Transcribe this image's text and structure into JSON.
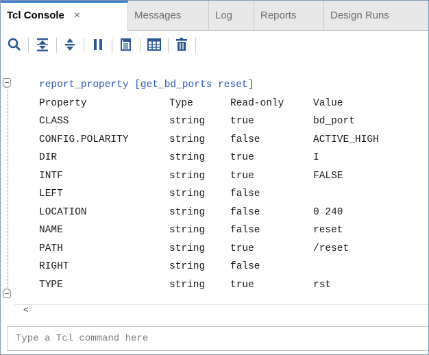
{
  "tabs": [
    {
      "label": "Tcl Console",
      "active": true,
      "close": "×"
    },
    {
      "label": "Messages"
    },
    {
      "label": "Log"
    },
    {
      "label": "Reports"
    },
    {
      "label": "Design Runs"
    }
  ],
  "toolbar": {
    "buttons": [
      "search-icon",
      "collapse-all-icon",
      "expand-all-icon",
      "pause-icon",
      "copy-icon",
      "columns-icon",
      "trash-icon"
    ]
  },
  "console": {
    "command": "report_property [get_bd_ports reset]",
    "headers": {
      "property": "Property",
      "type": "Type",
      "readonly": "Read-only",
      "value": "Value"
    },
    "rows": [
      {
        "property": "CLASS",
        "type": "string",
        "readonly": "true",
        "value": "bd_port"
      },
      {
        "property": "CONFIG.POLARITY",
        "type": "string",
        "readonly": "false",
        "value": "ACTIVE_HIGH"
      },
      {
        "property": "DIR",
        "type": "string",
        "readonly": "true",
        "value": "I"
      },
      {
        "property": "INTF",
        "type": "string",
        "readonly": "true",
        "value": "FALSE"
      },
      {
        "property": "LEFT",
        "type": "string",
        "readonly": "false",
        "value": ""
      },
      {
        "property": "LOCATION",
        "type": "string",
        "readonly": "false",
        "value": "0 240"
      },
      {
        "property": "NAME",
        "type": "string",
        "readonly": "false",
        "value": "reset"
      },
      {
        "property": "PATH",
        "type": "string",
        "readonly": "true",
        "value": "/reset"
      },
      {
        "property": "RIGHT",
        "type": "string",
        "readonly": "false",
        "value": ""
      },
      {
        "property": "TYPE",
        "type": "string",
        "readonly": "true",
        "value": "rst"
      }
    ]
  },
  "scroll_left_arrow": "<",
  "input": {
    "placeholder": "Type a Tcl command here",
    "value": ""
  },
  "colors": {
    "accent": "#3a79c6",
    "command": "#2d57b8",
    "toolbar_icon": "#2b5797"
  }
}
